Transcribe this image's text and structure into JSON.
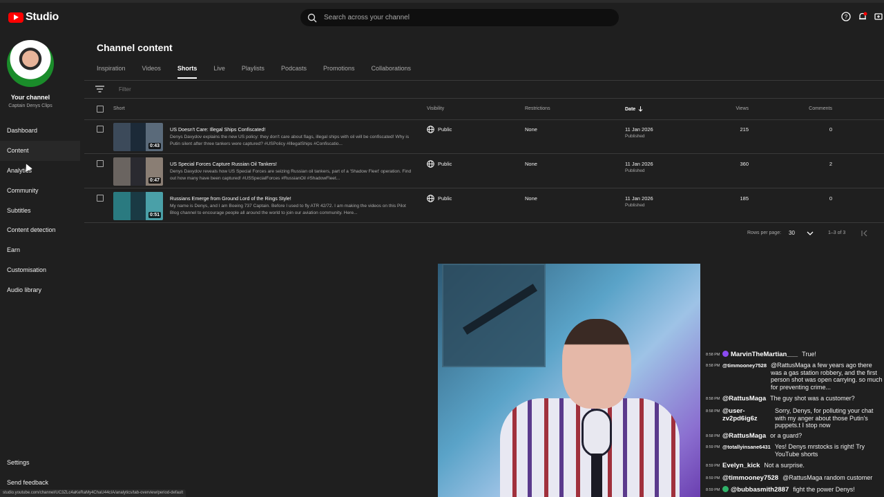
{
  "app": {
    "logo_text": "Studio",
    "search_placeholder": "Search across your channel",
    "status_url": "studio.youtube.com/channel/UC3ZLc4aKeRaMy4ChaU44cIA/analytics/tab-overview/period-default"
  },
  "sidebar": {
    "channel_label": "Your channel",
    "channel_name": "Captain Denys Clips",
    "items": [
      {
        "label": "Dashboard"
      },
      {
        "label": "Content"
      },
      {
        "label": "Analytics"
      },
      {
        "label": "Community"
      },
      {
        "label": "Subtitles"
      },
      {
        "label": "Content detection"
      },
      {
        "label": "Earn"
      },
      {
        "label": "Customisation"
      },
      {
        "label": "Audio library"
      }
    ],
    "active_item": "Content",
    "settings_label": "Settings",
    "feedback_label": "Send feedback"
  },
  "main": {
    "title": "Channel content",
    "tabs": [
      {
        "label": "Inspiration"
      },
      {
        "label": "Videos"
      },
      {
        "label": "Shorts"
      },
      {
        "label": "Live"
      },
      {
        "label": "Playlists"
      },
      {
        "label": "Podcasts"
      },
      {
        "label": "Promotions"
      },
      {
        "label": "Collaborations"
      }
    ],
    "active_tab": "Shorts",
    "filter_placeholder": "Filter",
    "columns": {
      "short": "Short",
      "visibility": "Visibility",
      "restrictions": "Restrictions",
      "date": "Date",
      "views": "Views",
      "comments": "Comments"
    },
    "rows": [
      {
        "duration": "0:43",
        "title": "US Doesn't Care: Illegal Ships Confiscated!",
        "description": "Denys Davydov explains the new US policy: they don't care about flags, illegal ships with oil will be confiscated! Why is Putin silent after three tankers were captured? #USPolicy #IllegalShips #Confiscatio...",
        "visibility": "Public",
        "restrictions": "None",
        "date": "11 Jan 2026",
        "status": "Published",
        "views": "215",
        "comments": "0"
      },
      {
        "duration": "0:47",
        "title": "US Special Forces Capture Russian Oil Tankers!",
        "description": "Denys Davydov reveals how US Special Forces are seizing Russian oil tankers, part of a 'Shadow Fleet' operation. Find out how many have been captured! #USSpecialForces #RussianOil #ShadowFleet...",
        "visibility": "Public",
        "restrictions": "None",
        "date": "11 Jan 2026",
        "status": "Published",
        "views": "360",
        "comments": "2"
      },
      {
        "duration": "0:51",
        "title": "Russians Emerge from Ground Lord of the Rings Style!",
        "description": "My name is Denys, and I am Boeing 737 Captain. Before I used to fly ATR 42/72. I am making the videos on this Pilot Blog channel to encourage people all around the world to join our aviation community. Here...",
        "visibility": "Public",
        "restrictions": "None",
        "date": "11 Jan 2026",
        "status": "Published",
        "views": "185",
        "comments": "0"
      }
    ],
    "pager": {
      "rows_label": "Rows per page:",
      "rows_value": "30",
      "range": "1–3 of 3"
    }
  },
  "chat": [
    {
      "time": "8:58 PM",
      "user": "MarvinTheMartian___",
      "text": "True!"
    },
    {
      "time": "8:58 PM",
      "user": "@timmooney7528",
      "text": "@RattusMaga a few years ago there was a gas station robbery, and the first person shot was open carrying. so much for preventing crime..."
    },
    {
      "time": "8:58 PM",
      "user": "@RattusMaga",
      "text": "The guy shot was a customer?"
    },
    {
      "time": "8:58 PM",
      "user": "@user-zv2pd6ig6z",
      "text": "Sorry, Denys, for polluting your chat with my anger about those Putin's puppets.t I stop now"
    },
    {
      "time": "8:58 PM",
      "user": "@RattusMaga",
      "text": "or a guard?"
    },
    {
      "time": "8:59 PM",
      "user": "@totallyinsane6431",
      "text": "Yes! Denys mrstocks is right! Try YouTube shorts"
    },
    {
      "time": "8:59 PM",
      "user": "Evelyn_kick",
      "text": "Not a surprise."
    },
    {
      "time": "8:59 PM",
      "user": "@timmooney7528",
      "text": "@RattusMaga random customer"
    },
    {
      "time": "8:59 PM",
      "user": "@bubbasmith2887",
      "text": "fight the power Denys!"
    }
  ],
  "colors": {
    "background": "#1f1f1f",
    "brand_red": "#ff0000",
    "text": "#f1f1f1",
    "muted": "#aaaaaa"
  }
}
